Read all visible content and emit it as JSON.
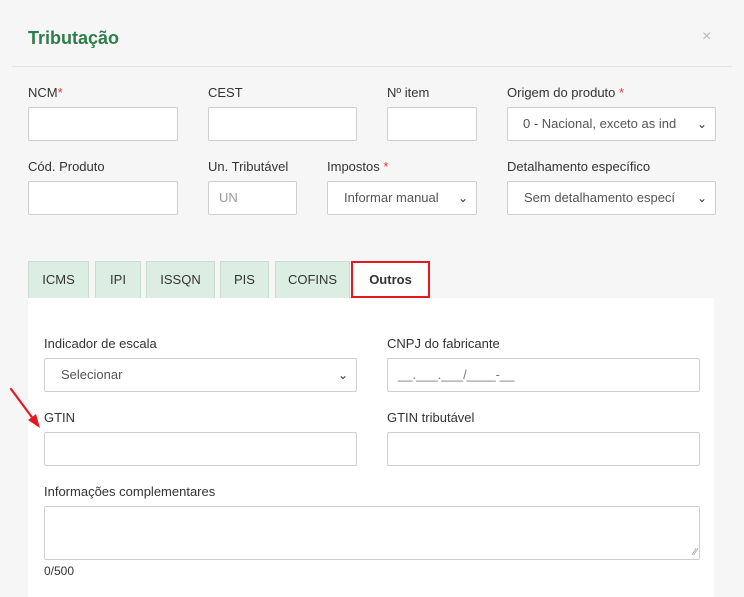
{
  "modal": {
    "title": "Tributação",
    "close_icon": "×"
  },
  "fields": {
    "ncm": {
      "label": "NCM",
      "required": "*",
      "value": ""
    },
    "cest": {
      "label": "CEST",
      "value": ""
    },
    "n_item": {
      "label": "Nº item",
      "value": ""
    },
    "origem": {
      "label": "Origem do produto",
      "required": "*",
      "selected": "0 - Nacional, exceto as ind"
    },
    "cod_produto": {
      "label": "Cód. Produto",
      "value": ""
    },
    "un_tributavel": {
      "label": "Un. Tributável",
      "placeholder": "UN"
    },
    "impostos": {
      "label": "Impostos",
      "required": "*",
      "selected": "Informar manual"
    },
    "detalhamento": {
      "label": "Detalhamento específico",
      "selected": "Sem detalhamento especí"
    }
  },
  "tabs": [
    {
      "label": "ICMS",
      "active": false
    },
    {
      "label": "IPI",
      "active": false
    },
    {
      "label": "ISSQN",
      "active": false
    },
    {
      "label": "PIS",
      "active": false
    },
    {
      "label": "COFINS",
      "active": false
    },
    {
      "label": "Outros",
      "active": true
    }
  ],
  "outros": {
    "indicador_escala": {
      "label": "Indicador de escala",
      "selected": "Selecionar"
    },
    "cnpj_fabricante": {
      "label": "CNPJ do fabricante",
      "placeholder": "__.___.___/____-__"
    },
    "gtin": {
      "label": "GTIN",
      "value": ""
    },
    "gtin_tributavel": {
      "label": "GTIN tributável",
      "value": ""
    },
    "info_complementares": {
      "label": "Informações complementares",
      "counter": "0/500"
    }
  },
  "colors": {
    "title": "#2e7d4a",
    "tab_bg": "#dceee3",
    "highlight": "#e5191f",
    "arrow": "#e5191f"
  },
  "icons": {
    "select_chevron": "chevron-down-icon",
    "annotation_arrow": "red-arrow-icon"
  }
}
